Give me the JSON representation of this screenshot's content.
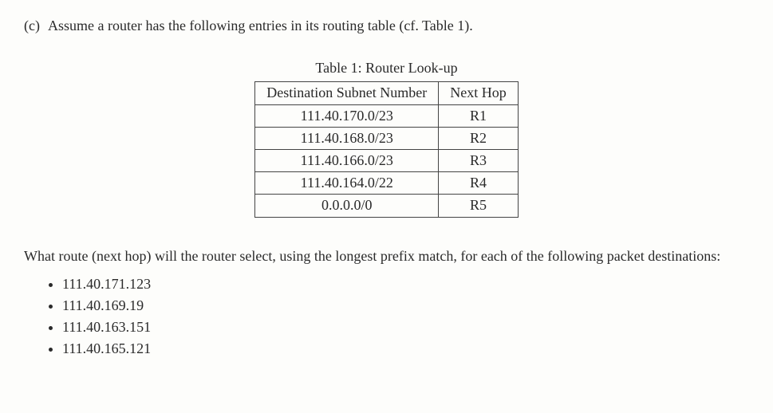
{
  "question": {
    "label": "(c)",
    "text": "Assume a router has the following entries in its routing table (cf. Table 1)."
  },
  "table": {
    "caption": "Table 1: Router Look-up",
    "headers": [
      "Destination Subnet Number",
      "Next Hop"
    ],
    "rows": [
      {
        "dest": "111.40.170.0/23",
        "hop": "R1"
      },
      {
        "dest": "111.40.168.0/23",
        "hop": "R2"
      },
      {
        "dest": "111.40.166.0/23",
        "hop": "R3"
      },
      {
        "dest": "111.40.164.0/22",
        "hop": "R4"
      },
      {
        "dest": "0.0.0.0/0",
        "hop": "R5"
      }
    ]
  },
  "prompt": "What route (next hop) will the router select, using the longest prefix match, for each of the following packet destinations:",
  "destinations": [
    "111.40.171.123",
    "111.40.169.19",
    "111.40.163.151",
    "111.40.165.121"
  ]
}
